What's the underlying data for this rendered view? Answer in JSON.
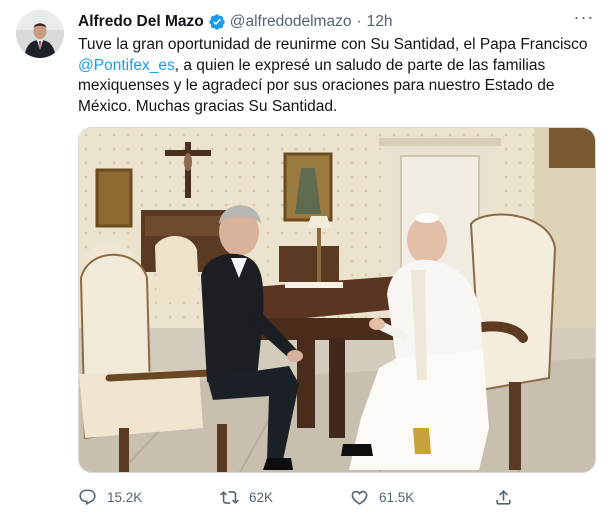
{
  "tweet": {
    "author_name": "Alfredo Del Mazo",
    "handle": "@alfredodelmazo",
    "separator": "·",
    "time": "12h",
    "more_label": "···",
    "text_part1": "Tuve la gran oportunidad de reunirme con Su Santidad, el Papa Francisco",
    "mention": "@Pontifex_es",
    "text_part2": ", a quien le expresé un saludo de parte de las familias mexiquenses y le agradecí por sus oraciones para nuestro Estado de México. Muchas gracias Su Santidad."
  },
  "actions": {
    "replies": "15.2K",
    "retweets": "62K",
    "likes": "61.5K"
  },
  "icons": {
    "verified": "verified-badge-icon",
    "reply": "reply-icon",
    "retweet": "retweet-icon",
    "like": "heart-icon",
    "share": "share-icon",
    "more": "more-icon"
  },
  "colors": {
    "accent": "#1d9bf0",
    "text": "#0f1419",
    "muted": "#536471"
  }
}
